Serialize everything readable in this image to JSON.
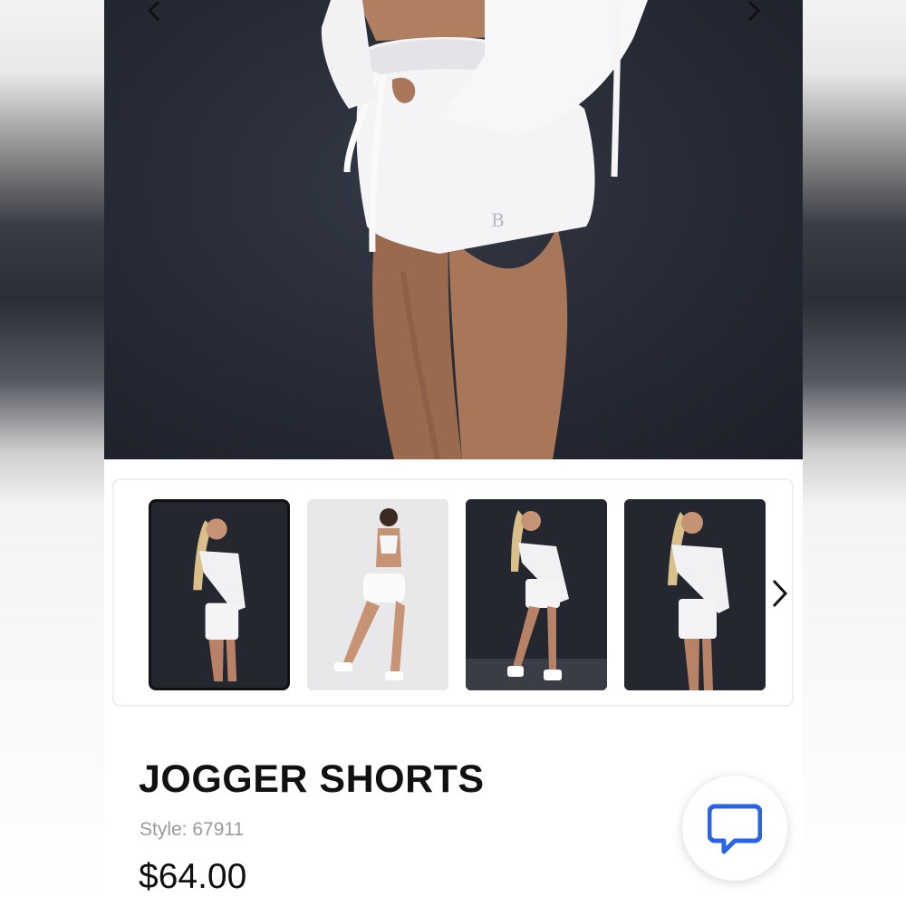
{
  "product": {
    "title": "JOGGER SHORTS",
    "style_label": "Style:",
    "style_number": "67911",
    "price": "$64.00"
  },
  "gallery": {
    "hero_icon": "product-photo",
    "prev_icon": "chevron-left-icon",
    "next_icon": "chevron-right-icon",
    "thumbnails": [
      {
        "background": "dark",
        "selected": true
      },
      {
        "background": "light",
        "selected": false
      },
      {
        "background": "dark",
        "selected": false
      },
      {
        "background": "dark",
        "selected": false
      }
    ],
    "thumbs_next_icon": "chevron-right-icon"
  },
  "chat": {
    "icon": "chat-bubble-icon",
    "color": "#2a63e4"
  },
  "colors": {
    "photo_background": "#262a34",
    "text": "#111111",
    "muted_text": "#9a9a9a"
  }
}
